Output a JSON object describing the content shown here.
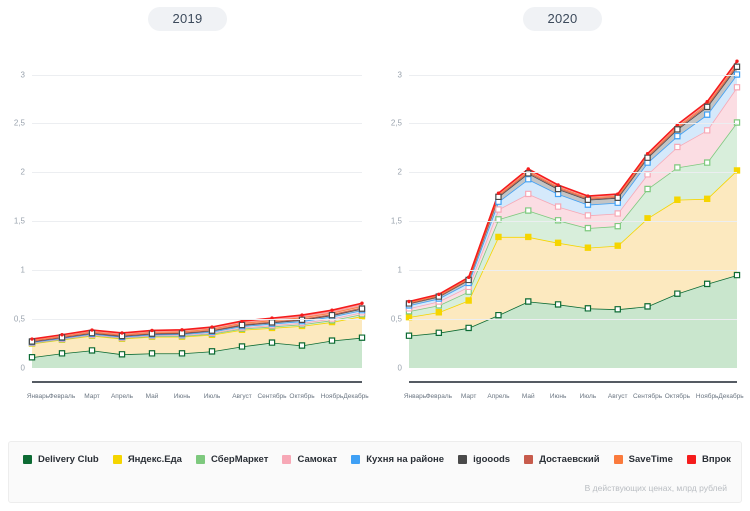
{
  "footer_note": "В действующих ценах, млрд рублей",
  "legend": [
    {
      "label": "Delivery Club",
      "color": "#0d6b34",
      "fill": "#c9e6cd",
      "icon": "legend-swatch-icon"
    },
    {
      "label": "Яндекс.Еда",
      "color": "#f5d500",
      "fill": "#fce9bf",
      "icon": "legend-swatch-icon"
    },
    {
      "label": "СберМаркет",
      "color": "#7ec97e",
      "fill": "#d8eedb",
      "icon": "legend-swatch-icon"
    },
    {
      "label": "Самокат",
      "color": "#f7a8b6",
      "fill": "#fbdde3",
      "icon": "legend-swatch-icon"
    },
    {
      "label": "Кухня на районе",
      "color": "#3fa0f5",
      "fill": "#d5e9fb",
      "icon": "legend-swatch-icon"
    },
    {
      "label": "igooods",
      "color": "#4a4a4a",
      "fill": "#c3c4c5",
      "icon": "legend-swatch-icon"
    },
    {
      "label": "Достаевский",
      "color": "#c75b4c",
      "fill": "#e9b7b0",
      "icon": "legend-swatch-icon"
    },
    {
      "label": "SaveTime",
      "color": "#fa7a3c",
      "fill": "#fbc4a4",
      "icon": "legend-swatch-icon"
    },
    {
      "label": "Впрок",
      "color": "#f51c1c",
      "fill": "#f9a1a1",
      "icon": "legend-swatch-icon"
    }
  ],
  "chart_data": {
    "type": "area",
    "stacked": true,
    "title": "",
    "xlabel": "",
    "ylabel": "",
    "ylim": [
      0,
      3.2
    ],
    "yticks": [
      0,
      0.5,
      1,
      1.5,
      2,
      2.5,
      3
    ],
    "ytick_labels": [
      "0",
      "0,5",
      "1",
      "1,5",
      "2",
      "2,5",
      "3"
    ],
    "grid": true,
    "legend_position": "bottom",
    "units": "млрд рублей",
    "categories": [
      "Январь",
      "Февраль",
      "Март",
      "Апрель",
      "Май",
      "Июнь",
      "Июль",
      "Август",
      "Сентябрь",
      "Октябрь",
      "Ноябрь",
      "Декабрь"
    ],
    "panels": [
      {
        "title": "2019",
        "series": [
          {
            "name": "Delivery Club",
            "values": [
              0.11,
              0.15,
              0.18,
              0.14,
              0.15,
              0.15,
              0.17,
              0.22,
              0.26,
              0.23,
              0.28,
              0.31
            ]
          },
          {
            "name": "Яндекс.Еда",
            "values": [
              0.14,
              0.14,
              0.15,
              0.16,
              0.17,
              0.17,
              0.17,
              0.17,
              0.15,
              0.2,
              0.19,
              0.22
            ]
          },
          {
            "name": "СберМаркет",
            "values": [
              0.005,
              0.005,
              0.006,
              0.006,
              0.007,
              0.008,
              0.01,
              0.012,
              0.014,
              0.016,
              0.018,
              0.02
            ]
          },
          {
            "name": "Самокат",
            "values": [
              0.004,
              0.004,
              0.005,
              0.005,
              0.006,
              0.007,
              0.009,
              0.011,
              0.013,
              0.015,
              0.017,
              0.019
            ]
          },
          {
            "name": "Кухня на районе",
            "values": [
              0.006,
              0.007,
              0.008,
              0.008,
              0.009,
              0.01,
              0.012,
              0.014,
              0.016,
              0.018,
              0.02,
              0.022
            ]
          },
          {
            "name": "igooods",
            "values": [
              0.006,
              0.007,
              0.008,
              0.008,
              0.009,
              0.01,
              0.011,
              0.012,
              0.013,
              0.014,
              0.015,
              0.016
            ]
          },
          {
            "name": "Достаевский",
            "values": [
              0.005,
              0.005,
              0.006,
              0.006,
              0.006,
              0.007,
              0.007,
              0.008,
              0.008,
              0.009,
              0.009,
              0.01
            ]
          },
          {
            "name": "SaveTime",
            "values": [
              0.008,
              0.009,
              0.01,
              0.01,
              0.011,
              0.011,
              0.012,
              0.013,
              0.014,
              0.015,
              0.016,
              0.017
            ]
          },
          {
            "name": "Впрок",
            "values": [
              0.012,
              0.013,
              0.015,
              0.015,
              0.016,
              0.017,
              0.018,
              0.02,
              0.022,
              0.024,
              0.026,
              0.028
            ]
          }
        ],
        "totals": [
          0.3,
          0.33,
          0.38,
          0.34,
          0.38,
          0.38,
          0.41,
          0.47,
          0.49,
          0.52,
          0.56,
          0.66
        ]
      },
      {
        "title": "2020",
        "series": [
          {
            "name": "Delivery Club",
            "values": [
              0.33,
              0.36,
              0.41,
              0.54,
              0.68,
              0.65,
              0.61,
              0.6,
              0.63,
              0.76,
              0.86,
              0.95
            ]
          },
          {
            "name": "Яндекс.Еда",
            "values": [
              0.19,
              0.21,
              0.28,
              0.8,
              0.66,
              0.63,
              0.62,
              0.65,
              0.9,
              0.96,
              0.87,
              1.07
            ]
          },
          {
            "name": "СберМаркет",
            "values": [
              0.06,
              0.07,
              0.09,
              0.18,
              0.27,
              0.23,
              0.2,
              0.2,
              0.3,
              0.33,
              0.37,
              0.49
            ]
          },
          {
            "name": "Самокат",
            "values": [
              0.03,
              0.04,
              0.05,
              0.1,
              0.17,
              0.14,
              0.13,
              0.13,
              0.15,
              0.21,
              0.33,
              0.36
            ]
          },
          {
            "name": "Кухня на районе",
            "values": [
              0.03,
              0.03,
              0.04,
              0.08,
              0.15,
              0.13,
              0.11,
              0.11,
              0.12,
              0.11,
              0.16,
              0.13
            ]
          },
          {
            "name": "igooods",
            "values": [
              0.02,
              0.02,
              0.03,
              0.05,
              0.06,
              0.05,
              0.05,
              0.05,
              0.05,
              0.07,
              0.08,
              0.08
            ]
          },
          {
            "name": "Достаевский",
            "values": [
              0.005,
              0.006,
              0.007,
              0.01,
              0.012,
              0.011,
              0.01,
              0.01,
              0.011,
              0.013,
              0.014,
              0.015
            ]
          },
          {
            "name": "SaveTime",
            "values": [
              0.006,
              0.007,
              0.008,
              0.011,
              0.013,
              0.012,
              0.011,
              0.011,
              0.012,
              0.014,
              0.015,
              0.016
            ]
          },
          {
            "name": "Впрок",
            "values": [
              0.009,
              0.01,
              0.012,
              0.016,
              0.02,
              0.018,
              0.017,
              0.017,
              0.018,
              0.021,
              0.023,
              0.025
            ]
          }
        ],
        "totals": [
          0.68,
          0.75,
          0.93,
          1.79,
          2.01,
          1.81,
          1.76,
          1.76,
          2.19,
          2.49,
          2.72,
          3.14
        ]
      }
    ]
  }
}
